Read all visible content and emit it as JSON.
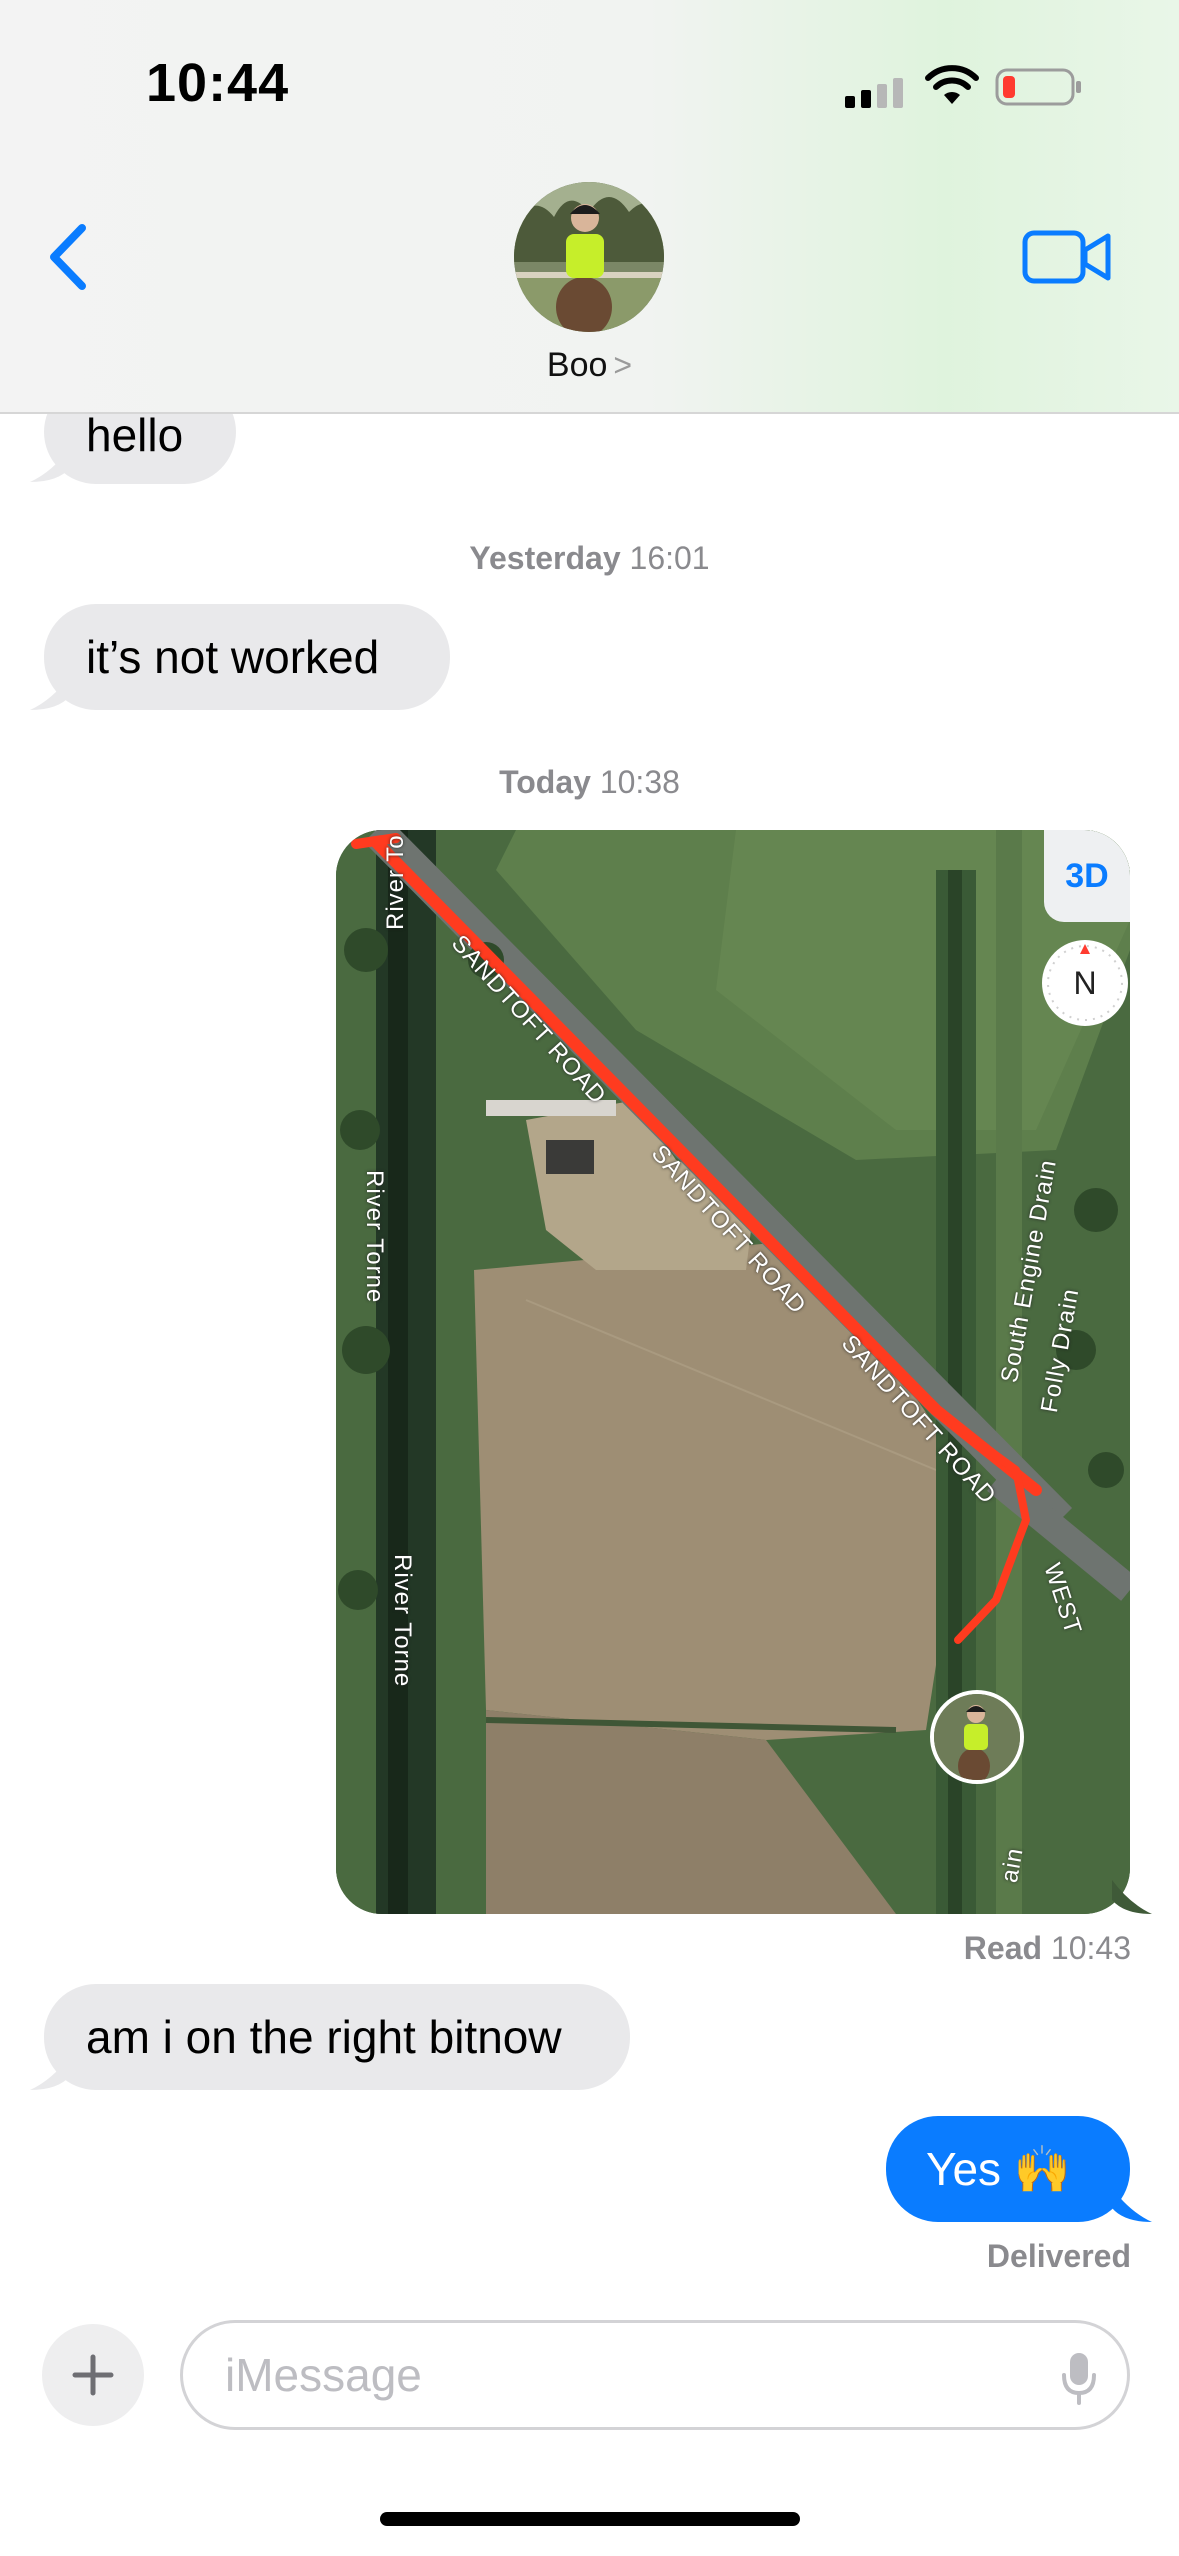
{
  "status_bar": {
    "time": "10:44"
  },
  "header": {
    "contact_name": "Boo",
    "contact_chevron": ">"
  },
  "messages": {
    "hello": "hello",
    "not_worked": "it’s not worked",
    "right_bit": "am i on the right bitnow",
    "yes": "Yes 🙌"
  },
  "timestamps": {
    "yesterday_day": "Yesterday",
    "yesterday_time": "16:01",
    "today_day": "Today",
    "today_time": "10:38"
  },
  "receipts": {
    "read_label": "Read",
    "read_time": "10:43",
    "delivered": "Delivered"
  },
  "map": {
    "button_3d": "3D",
    "compass": "N",
    "labels": {
      "road1": "SANDTOFT ROAD",
      "road2": "SANDTOFT ROAD",
      "road3": "SANDTOFT ROAD",
      "river_top": "River To",
      "river1": "River Torne",
      "river2": "River Torne",
      "south_engine": "South Engine Drain",
      "folly": "Folly Drain",
      "west": "WEST",
      "ain": "ain"
    },
    "route_color": "#ff3b1f"
  },
  "input": {
    "placeholder": "iMessage"
  },
  "colors": {
    "accent": "#0a7cff",
    "incoming_bubble": "#e9e9eb"
  }
}
